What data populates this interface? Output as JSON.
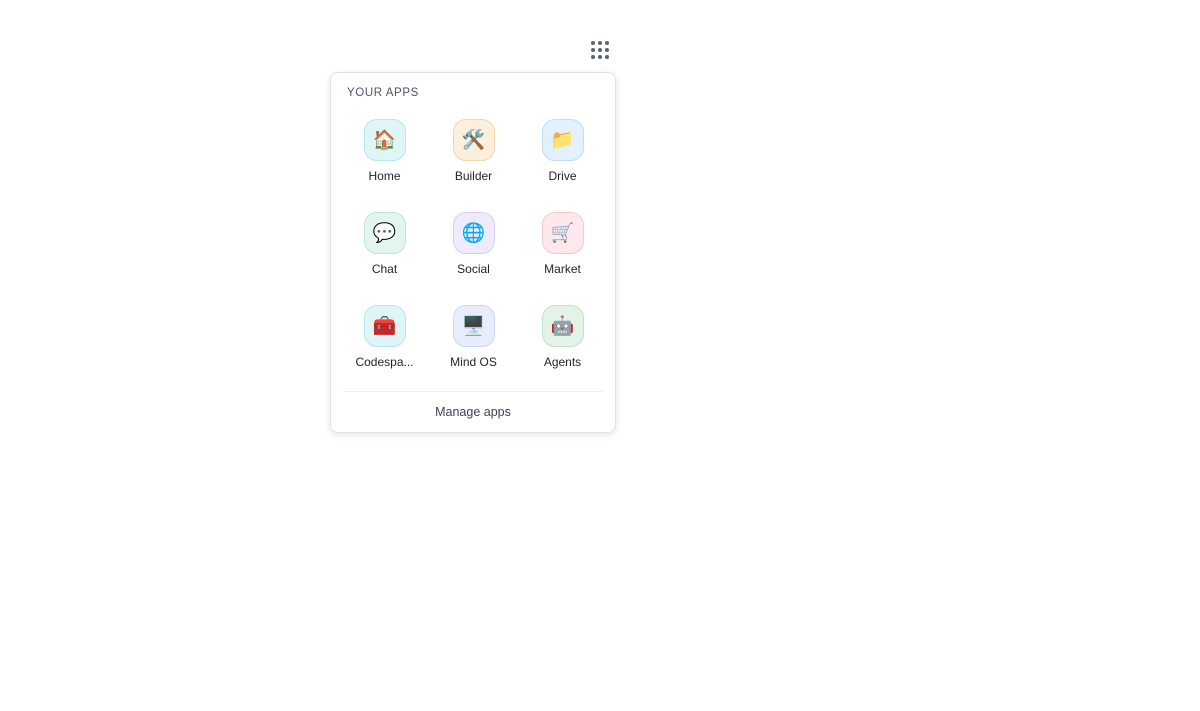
{
  "launcher": {
    "icon": "app-grid-icon"
  },
  "panel": {
    "title": "YOUR APPS",
    "manage_label": "Manage apps"
  },
  "apps": [
    {
      "label": "Home",
      "glyph": "🏠",
      "icon": "home-icon",
      "bg": "#dff6f8",
      "border": "#b8e6ea"
    },
    {
      "label": "Builder",
      "glyph": "🛠️",
      "icon": "builder-tools-icon",
      "bg": "#fcefdc",
      "border": "#efd6b0"
    },
    {
      "label": "Drive",
      "glyph": "📁",
      "icon": "folder-icon",
      "bg": "#e3f0fd",
      "border": "#c3dcf5"
    },
    {
      "label": "Chat",
      "glyph": "💬",
      "icon": "chat-bubble-icon",
      "bg": "#e2f6ee",
      "border": "#bfe6d4"
    },
    {
      "label": "Social",
      "glyph": "🌐",
      "icon": "globe-icon",
      "bg": "#efeafd",
      "border": "#d7cdf5"
    },
    {
      "label": "Market",
      "glyph": "🛒",
      "icon": "shopping-cart-icon",
      "bg": "#fde9ec",
      "border": "#f3c9d0"
    },
    {
      "label": "Codespa...",
      "glyph": "🧰",
      "icon": "toolbox-icon",
      "bg": "#dff6f8",
      "border": "#b8e6ea"
    },
    {
      "label": "Mind OS",
      "glyph": "🖥️",
      "icon": "desktop-computer-icon",
      "bg": "#e8edfd",
      "border": "#ccd6f5"
    },
    {
      "label": "Agents",
      "glyph": "🤖",
      "icon": "robot-icon",
      "bg": "#e3f3e7",
      "border": "#c2e2ca"
    }
  ]
}
